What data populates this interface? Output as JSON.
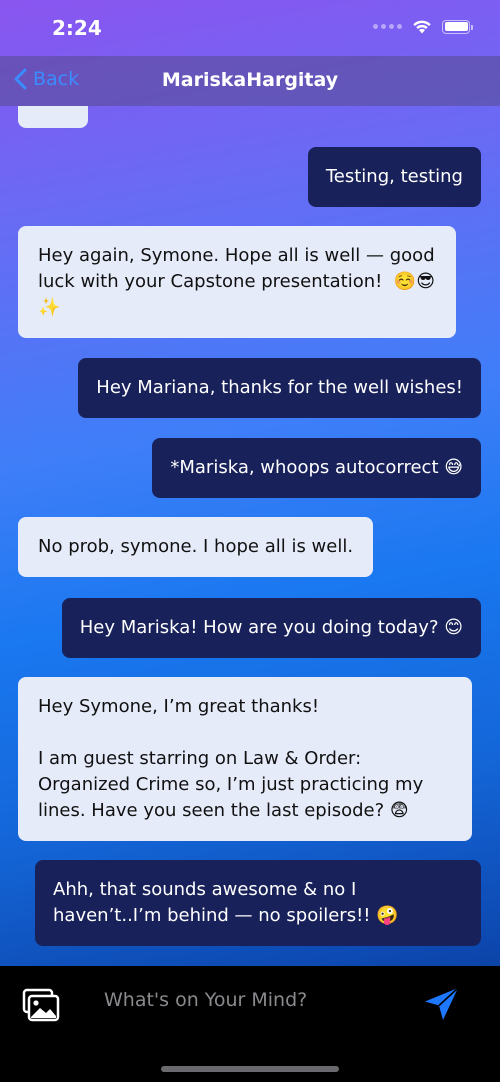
{
  "status_bar": {
    "time": "2:24",
    "icons": [
      "signal-dots-icon",
      "wifi-icon",
      "battery-icon"
    ]
  },
  "nav": {
    "back_label": "Back",
    "back_icon": "chevron-left-icon",
    "title": "MariskaHargitay"
  },
  "messages": [
    {
      "direction": "in",
      "text": ""
    },
    {
      "direction": "out",
      "text": "Testing, testing"
    },
    {
      "direction": "in",
      "text": "Hey again, Symone. Hope all is well — good luck with your Capstone presentation!  ☺️😎\n✨"
    },
    {
      "direction": "out",
      "text": "Hey Mariana, thanks for the well wishes!"
    },
    {
      "direction": "out",
      "text": "*Mariska, whoops autocorrect 😅"
    },
    {
      "direction": "in",
      "text": "No prob, symone. I hope all is well."
    },
    {
      "direction": "out",
      "text": "Hey Mariska! How are you doing today? 😊"
    },
    {
      "direction": "in",
      "text": "Hey Symone, I’m great thanks!\n\nI am guest starring on Law & Order: Organized Crime so, I’m just practicing my lines. Have you seen the last episode? 😨"
    },
    {
      "direction": "out",
      "text": "Ahh, that sounds awesome & no I haven’t..I’m behind — no spoilers!! 🤪"
    }
  ],
  "composer": {
    "placeholder": "What's on Your Mind?",
    "value": "",
    "photo_icon": "photo-library-icon",
    "send_icon": "send-icon"
  },
  "colors": {
    "accent": "#3a8cff",
    "incoming_bubble": "#e6ebfa",
    "outgoing_bubble": "#18215a",
    "send_button": "#1e78ff"
  }
}
